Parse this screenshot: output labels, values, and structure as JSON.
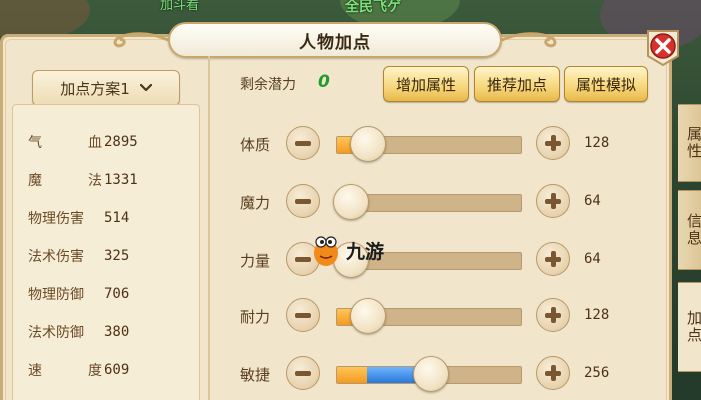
{
  "world": {
    "top_text": "全民飞ゲ",
    "top_left_text": "加斗看"
  },
  "panel": {
    "title": "人物加点",
    "close_icon": "close-icon"
  },
  "scheme": {
    "label": "加点方案1",
    "icon": "chevron-down-icon"
  },
  "stats": [
    {
      "name_a": "气",
      "name_b": "血",
      "value": "2895"
    },
    {
      "name_a": "魔",
      "name_b": "法",
      "value": "1331"
    },
    {
      "name_a": "物理伤害",
      "name_b": "",
      "value": "514"
    },
    {
      "name_a": "法术伤害",
      "name_b": "",
      "value": "325"
    },
    {
      "name_a": "物理防御",
      "name_b": "",
      "value": "706"
    },
    {
      "name_a": "法术防御",
      "name_b": "",
      "value": "380"
    },
    {
      "name_a": "速",
      "name_b": "度",
      "value": "609"
    }
  ],
  "potential": {
    "label": "剩余潜力",
    "value": "0"
  },
  "actions": {
    "add": "增加属性",
    "recommend": "推荐加点",
    "simulate": "属性模拟"
  },
  "attributes": [
    {
      "name": "体质",
      "value": "128",
      "orange": 0.16,
      "blue": 0.17
    },
    {
      "name": "魔力",
      "value": "64",
      "orange": 0.07,
      "blue": 0.08
    },
    {
      "name": "力量",
      "value": "64",
      "orange": 0.07,
      "blue": 0.08
    },
    {
      "name": "耐力",
      "value": "128",
      "orange": 0.16,
      "blue": 0.17
    },
    {
      "name": "敏捷",
      "value": "256",
      "orange": 0.16,
      "blue": 0.51
    }
  ],
  "side_tabs": [
    {
      "label": "属性",
      "active": false
    },
    {
      "label": "信息",
      "active": false
    },
    {
      "label": "加点",
      "active": true
    }
  ],
  "watermark": {
    "text": "九游"
  },
  "colors": {
    "panel": "#f1e6cc",
    "accent_orange": "#f49b1f",
    "accent_blue": "#2b78d8",
    "potential_green": "#1f9c2d"
  }
}
